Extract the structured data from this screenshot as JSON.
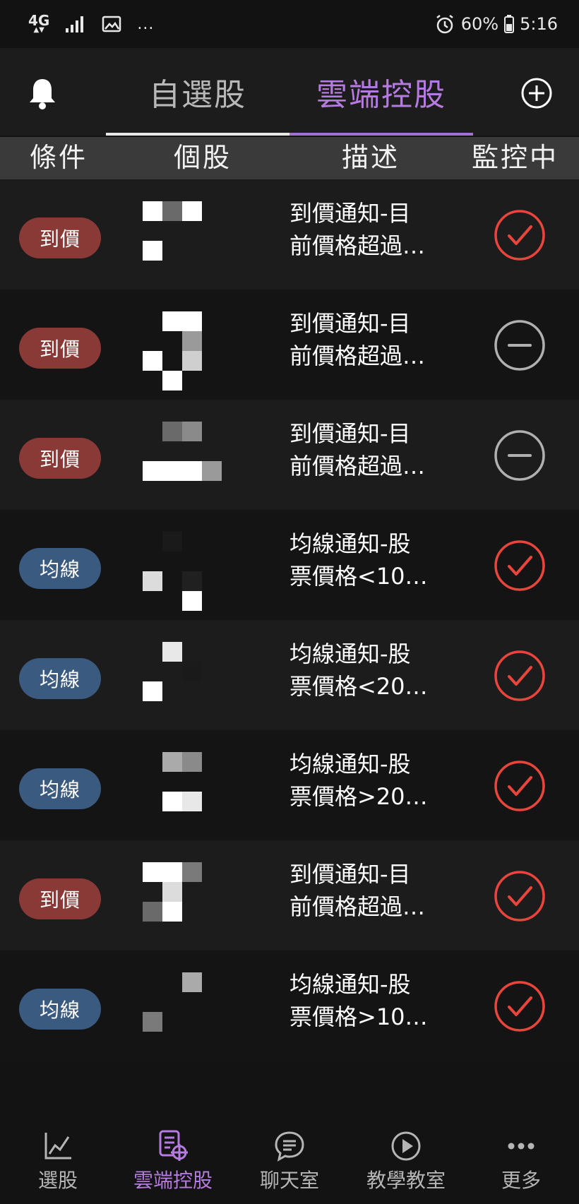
{
  "status_bar": {
    "network_top": "4G",
    "network_bottom": "▲▼",
    "dots": "...",
    "battery_percent": "60%",
    "time": "5:16"
  },
  "header": {
    "tabs": [
      {
        "label": "自選股",
        "active": false
      },
      {
        "label": "雲端控股",
        "active": true
      }
    ],
    "colors": {
      "active": "#b67be0",
      "inactive": "#b8b8b8"
    }
  },
  "columns": {
    "condition": "條件",
    "stock": "個股",
    "description": "描述",
    "monitoring": "監控中"
  },
  "rows": [
    {
      "badge": "到價",
      "badge_type": "price",
      "desc_line1": "到價通知-目",
      "desc_line2": "前價格超過…",
      "status": "check"
    },
    {
      "badge": "到價",
      "badge_type": "price",
      "desc_line1": "到價通知-目",
      "desc_line2": "前價格超過…",
      "status": "minus"
    },
    {
      "badge": "到價",
      "badge_type": "price",
      "desc_line1": "到價通知-目",
      "desc_line2": "前價格超過…",
      "status": "minus"
    },
    {
      "badge": "均線",
      "badge_type": "ma",
      "desc_line1": "均線通知-股",
      "desc_line2": "票價格<10…",
      "status": "check"
    },
    {
      "badge": "均線",
      "badge_type": "ma",
      "desc_line1": "均線通知-股",
      "desc_line2": "票價格<20…",
      "status": "check"
    },
    {
      "badge": "均線",
      "badge_type": "ma",
      "desc_line1": "均線通知-股",
      "desc_line2": "票價格>20…",
      "status": "check"
    },
    {
      "badge": "到價",
      "badge_type": "price",
      "desc_line1": "到價通知-目",
      "desc_line2": "前價格超過…",
      "status": "check"
    },
    {
      "badge": "均線",
      "badge_type": "ma",
      "desc_line1": "均線通知-股",
      "desc_line2": "票價格>10…",
      "status": "check"
    }
  ],
  "bottom_nav": [
    {
      "label": "選股",
      "icon": "line-chart-icon",
      "active": false
    },
    {
      "label": "雲端控股",
      "icon": "document-target-icon",
      "active": true
    },
    {
      "label": "聊天室",
      "icon": "chat-icon",
      "active": false
    },
    {
      "label": "教學教室",
      "icon": "play-icon",
      "active": false
    },
    {
      "label": "更多",
      "icon": "more-dots-icon",
      "active": false
    }
  ],
  "colors": {
    "accent_purple": "#b67be0",
    "check_red": "#e8453c",
    "minus_gray": "#b0b0b0",
    "badge_price": "#8a3a36",
    "badge_ma": "#3b5a80"
  }
}
